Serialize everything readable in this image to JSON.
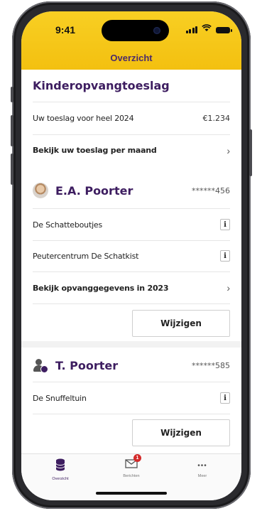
{
  "status": {
    "time": "9:41"
  },
  "header": {
    "title": "Overzicht"
  },
  "toeslag": {
    "title": "Kinderopvangtoeslag",
    "year_label": "Uw toeslag voor heel 2024",
    "year_amount": "€1.234",
    "month_link": "Bekijk uw toeslag per maand"
  },
  "child1": {
    "name": "E.A. Poorter",
    "bsn": "******456",
    "providers": [
      "De Schatteboutjes",
      "Peutercentrum De Schatkist"
    ],
    "link": "Bekijk opvanggegevens in 2023",
    "button": "Wijzigen"
  },
  "child2": {
    "name": "T. Poorter",
    "bsn": "******585",
    "providers": [
      "De Snuffeltuin"
    ],
    "button": "Wijzigen"
  },
  "tabs": [
    {
      "label": "Overzicht",
      "icon": "database-icon",
      "active": true
    },
    {
      "label": "Berichten",
      "icon": "envelope-icon",
      "badge": "1"
    },
    {
      "label": "Meer",
      "icon": "more-icon",
      "symbol": "•••"
    }
  ],
  "info_glyph": "i",
  "chevron": "›",
  "colors": {
    "header": "#f3c010",
    "accent": "#3d1d60"
  }
}
